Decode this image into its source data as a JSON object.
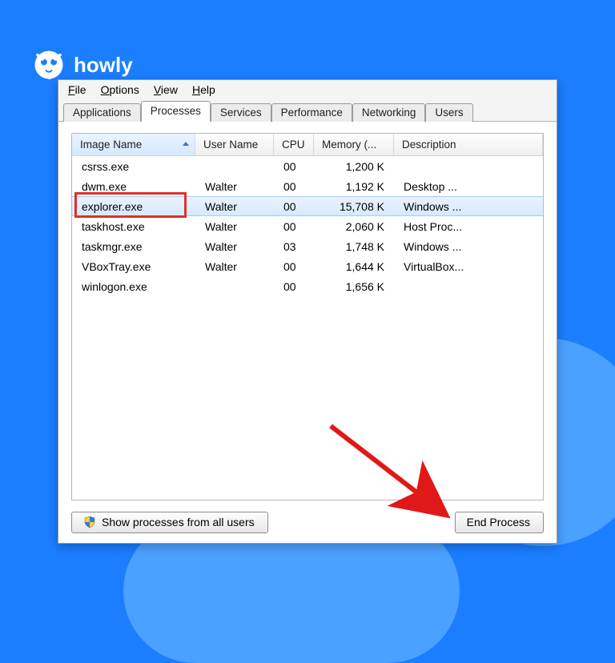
{
  "brand": {
    "name": "howly"
  },
  "menu": {
    "file": "File",
    "options": "Options",
    "view": "View",
    "help": "Help"
  },
  "tabs": {
    "applications": "Applications",
    "processes": "Processes",
    "services": "Services",
    "performance": "Performance",
    "networking": "Networking",
    "users": "Users"
  },
  "columns": {
    "image": "Image Name",
    "user": "User Name",
    "cpu": "CPU",
    "memory": "Memory (...",
    "desc": "Description"
  },
  "rows": [
    {
      "image": "csrss.exe",
      "user": "",
      "cpu": "00",
      "mem": "1,200 K",
      "desc": ""
    },
    {
      "image": "dwm.exe",
      "user": "Walter",
      "cpu": "00",
      "mem": "1,192 K",
      "desc": "Desktop ..."
    },
    {
      "image": "explorer.exe",
      "user": "Walter",
      "cpu": "00",
      "mem": "15,708 K",
      "desc": "Windows ..."
    },
    {
      "image": "taskhost.exe",
      "user": "Walter",
      "cpu": "00",
      "mem": "2,060 K",
      "desc": "Host Proc..."
    },
    {
      "image": "taskmgr.exe",
      "user": "Walter",
      "cpu": "03",
      "mem": "1,748 K",
      "desc": "Windows ..."
    },
    {
      "image": "VBoxTray.exe",
      "user": "Walter",
      "cpu": "00",
      "mem": "1,644 K",
      "desc": "VirtualBox..."
    },
    {
      "image": "winlogon.exe",
      "user": "",
      "cpu": "00",
      "mem": "1,656 K",
      "desc": ""
    }
  ],
  "buttons": {
    "show_all": "Show processes from all users",
    "end": "End Process"
  }
}
